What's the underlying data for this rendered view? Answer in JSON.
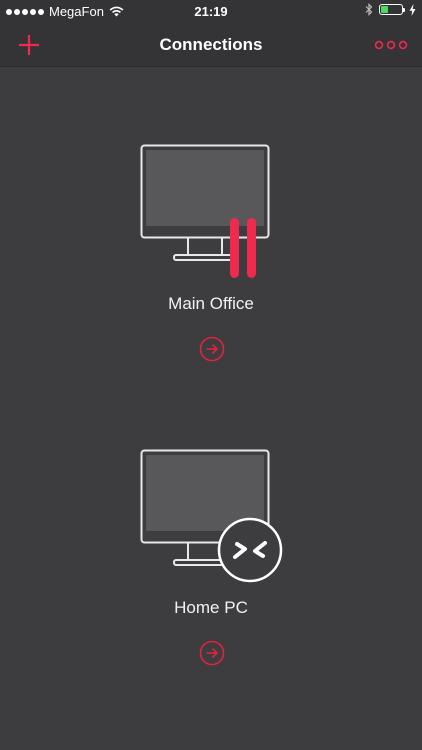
{
  "status_bar": {
    "carrier": "MegaFon",
    "time": "21:19"
  },
  "nav": {
    "title": "Connections",
    "add_icon": "plus-icon",
    "more_icon": "more-dots-icon"
  },
  "connections": [
    {
      "name": "Main Office",
      "badge_icon": "paused-icon"
    },
    {
      "name": "Home PC",
      "badge_icon": "remote-connect-icon"
    }
  ],
  "colors": {
    "accent": "#f0294f",
    "background": "#3d3c3f",
    "bar": "#343336",
    "battery": "#4cd964"
  }
}
